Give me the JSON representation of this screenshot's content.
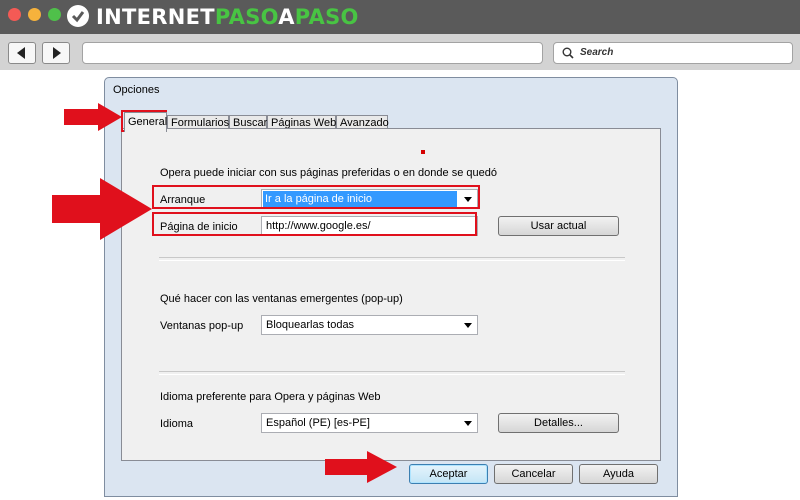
{
  "site": {
    "logo_part1": "INTERNET",
    "logo_part2": "PASO",
    "logo_part3": "A",
    "logo_part4": "PASO",
    "search_placeholder": "Search"
  },
  "dialog": {
    "title": "Opciones",
    "tabs": [
      "General",
      "Formularios",
      "Buscar",
      "Páginas Web",
      "Avanzado"
    ],
    "startup": {
      "heading": "Opera puede iniciar con sus páginas preferidas o en donde se quedó",
      "arranque_label": "Arranque",
      "arranque_value": "Ir a la página de inicio",
      "homepage_label": "Página de inicio",
      "homepage_value": "http://www.google.es/",
      "use_current_button": "Usar actual"
    },
    "popups": {
      "heading": "Qué hacer con las ventanas emergentes (pop-up)",
      "label": "Ventanas pop-up",
      "value": "Bloquearlas todas"
    },
    "language": {
      "heading": "Idioma preferente para Opera y páginas Web",
      "label": "Idioma",
      "value": "Español (PE) [es-PE]",
      "details_button": "Detalles..."
    },
    "buttons": {
      "accept": "Aceptar",
      "cancel": "Cancelar",
      "help": "Ayuda"
    }
  },
  "colors": {
    "highlight": "#e0101c",
    "logo_accent": "#48c443",
    "selection": "#3399ff"
  }
}
